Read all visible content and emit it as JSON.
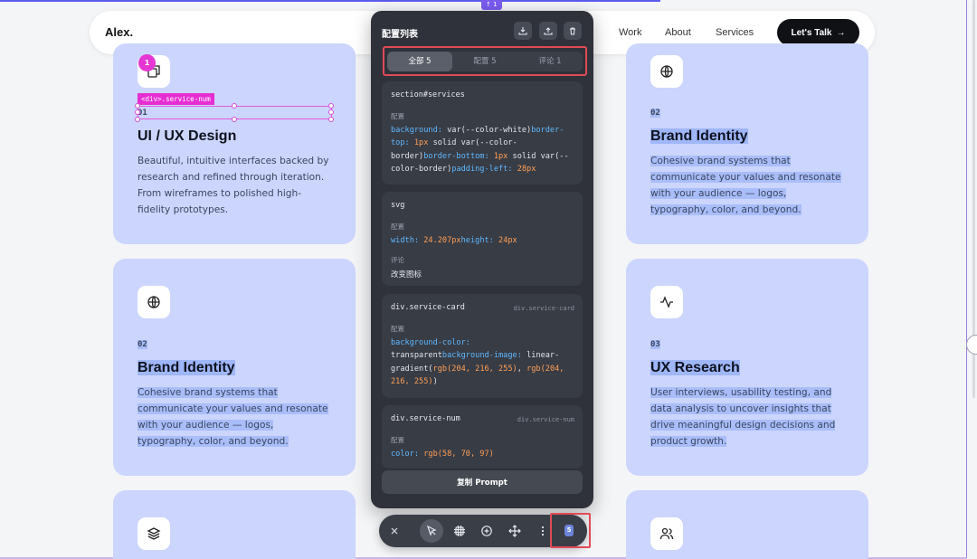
{
  "topbar": {
    "tag": "↑ 1"
  },
  "navbar": {
    "logo": "Alex.",
    "links": [
      "Work",
      "About",
      "Services"
    ],
    "cta_label": "Let's Talk",
    "cta_arrow": "→"
  },
  "cards": [
    {
      "num": "01",
      "title": "UI / UX Design",
      "desc": [
        "Beautiful, intuitive interfaces backed by",
        "research and refined through iteration.",
        "From wireframes to polished high-",
        "fidelity prototypes."
      ],
      "icon": "layout-icon"
    },
    {
      "num": "02",
      "title": "Brand Identity",
      "desc": [
        "Cohesive brand systems that",
        "communicate your values and resonate",
        "with your audience — logos,",
        "typography, color, and beyond."
      ],
      "icon": "globe-icon"
    },
    {
      "num": "02",
      "title": "Brand Identity",
      "desc": [
        "Cohesive brand systems that",
        "communicate your values and resonate",
        "with your audience — logos,",
        "typography, color, and beyond."
      ],
      "icon": "globe-icon"
    },
    {
      "num": "03",
      "title": "UX Research",
      "desc": [
        "User interviews, usability testing, and",
        "data analysis to uncover insights that",
        "drive meaningful design decisions and",
        "product growth."
      ],
      "icon": "activity-icon"
    }
  ],
  "bottom_cards": {
    "left_icon": "layers-icon",
    "right_icon": "users-icon"
  },
  "inspector": {
    "badge": "1",
    "tag": "<div>.service-num"
  },
  "panel": {
    "title": "配置列表",
    "tabs": [
      "全部 5",
      "配置 5",
      "评论 1"
    ],
    "items": [
      {
        "selector": "section#services",
        "label": "配置",
        "code": [
          [
            [
              "k",
              "background: "
            ],
            [
              "t",
              "var(--color-white)"
            ],
            [
              "k",
              "border-"
            ]
          ],
          [
            [
              "k",
              "top: "
            ],
            [
              "v",
              "1px"
            ],
            [
              "t",
              " solid var(--color-"
            ]
          ],
          [
            [
              "t",
              "border)"
            ],
            [
              "k",
              "border-bottom: "
            ],
            [
              "v",
              "1px"
            ],
            [
              "t",
              " solid var(--"
            ]
          ],
          [
            [
              "t",
              "color-border)"
            ],
            [
              "k",
              "padding-left: "
            ],
            [
              "v",
              "28px"
            ]
          ]
        ]
      },
      {
        "selector": "svg",
        "label": "配置",
        "code": [
          [
            [
              "k",
              "width: "
            ],
            [
              "v",
              "24.207px"
            ],
            [
              "k",
              "height: "
            ],
            [
              "v",
              "24px"
            ]
          ]
        ],
        "comment_label": "评论",
        "comment": "改变图标"
      },
      {
        "selector": "div.service-card",
        "selector_right": "div.service-card",
        "label": "配置",
        "code": [
          [
            [
              "k",
              "background-color:"
            ]
          ],
          [
            [
              "t",
              "transparent"
            ],
            [
              "k",
              "background-image: "
            ],
            [
              "t",
              "linear-"
            ]
          ],
          [
            [
              "t",
              "gradient("
            ],
            [
              "v",
              "rgb(204, 216, 255)"
            ],
            [
              "t",
              ", "
            ],
            [
              "v",
              "rgb(204,"
            ]
          ],
          [
            [
              "v",
              "216, 255)"
            ],
            [
              "t",
              ")"
            ]
          ]
        ]
      },
      {
        "selector": "div.service-num",
        "selector_right": "div.service-num",
        "label": "配置",
        "code": [
          [
            [
              "k",
              "color: "
            ],
            [
              "v",
              "rgb(58, 70, 97)"
            ]
          ]
        ]
      }
    ],
    "copy_label": "复制 Prompt"
  },
  "toolbar": {
    "count": "5"
  },
  "colors": {
    "card": "#ccd5fd",
    "panel": "#2f323a",
    "highlight": "#e04b57",
    "accent": "#e536d4"
  }
}
